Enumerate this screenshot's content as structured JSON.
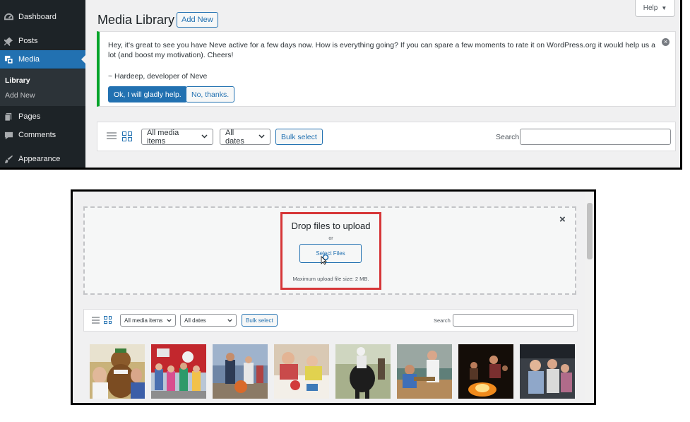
{
  "sidebar": {
    "items": [
      {
        "label": "Dashboard",
        "icon": "dashboard-icon"
      },
      {
        "label": "Posts",
        "icon": "pin-icon"
      },
      {
        "label": "Media",
        "icon": "media-icon",
        "active": true
      },
      {
        "label": "Pages",
        "icon": "pages-icon"
      },
      {
        "label": "Comments",
        "icon": "comment-icon"
      },
      {
        "label": "Appearance",
        "icon": "brush-icon"
      }
    ],
    "submenu": [
      {
        "label": "Library",
        "current": true
      },
      {
        "label": "Add New"
      }
    ]
  },
  "header": {
    "title": "Media Library",
    "add_new_label": "Add New",
    "help_label": "Help"
  },
  "notice": {
    "message": "Hey, it's great to see you have Neve active for a few days now. How is everything going? If you can spare a few moments to rate it on WordPress.org it would help us a lot (and boost my motivation). Cheers!",
    "signature": "~ Hardeep, developer of Neve",
    "yes_label": "Ok, I will gladly help.",
    "no_label": "No, thanks."
  },
  "toolbar": {
    "media_filter": "All media items",
    "date_filter": "All dates",
    "bulk_label": "Bulk select",
    "search_label": "Search"
  },
  "uploader": {
    "title": "Drop files to upload",
    "or": "or",
    "select_label": "Select Files",
    "max_size": "Maximum upload file size: 2 MB.",
    "close_glyph": "×"
  },
  "thumbnails": [
    {
      "name": "mascot-bear-photo"
    },
    {
      "name": "firetruck-kids-photo"
    },
    {
      "name": "basketball-kids-photo"
    },
    {
      "name": "arts-crafts-photo"
    },
    {
      "name": "horse-riding-photo"
    },
    {
      "name": "woodworking-photo"
    },
    {
      "name": "campfire-photo"
    },
    {
      "name": "campers-group-photo"
    }
  ],
  "colors": {
    "wp_blue": "#2271b1",
    "sidebar_dark": "#1d2327",
    "notice_green": "#00a32a",
    "highlight_red": "#d63638"
  }
}
